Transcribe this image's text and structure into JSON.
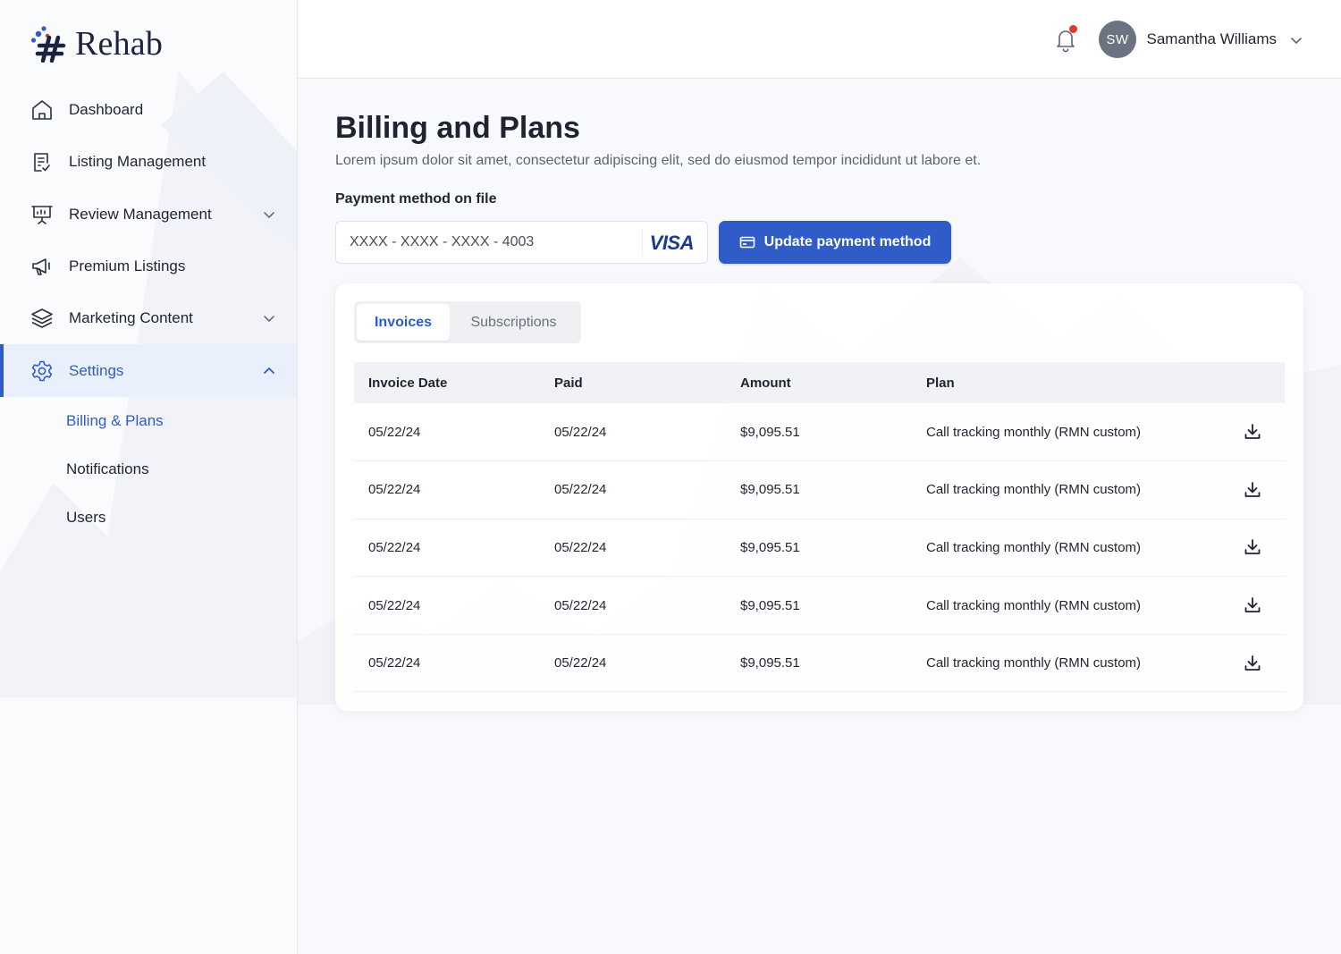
{
  "brand": {
    "name": "Rehab"
  },
  "sidebar": {
    "items": [
      {
        "label": "Dashboard",
        "icon": "home-icon"
      },
      {
        "label": "Listing Management",
        "icon": "document-check-icon"
      },
      {
        "label": "Review Management",
        "icon": "presentation-icon",
        "expandable": true
      },
      {
        "label": "Premium Listings",
        "icon": "megaphone-icon"
      },
      {
        "label": "Marketing Content",
        "icon": "layers-icon",
        "expandable": true
      },
      {
        "label": "Settings",
        "icon": "gear-icon",
        "expandable": true,
        "expanded": true,
        "active": true
      }
    ],
    "settings_sub": [
      {
        "label": "Billing & Plans",
        "active": true
      },
      {
        "label": "Notifications"
      },
      {
        "label": "Users"
      }
    ]
  },
  "header": {
    "user_initials": "SW",
    "user_name": "Samantha Williams",
    "has_notification": true
  },
  "page": {
    "title": "Billing and Plans",
    "description": "Lorem ipsum dolor sit amet, consectetur adipiscing elit, sed do eiusmod tempor incididunt ut labore et.",
    "payment_label": "Payment method on file",
    "card_number": "XXXX - XXXX - XXXX - 4003",
    "card_brand": "VISA",
    "update_button": "Update payment method"
  },
  "tabs": [
    {
      "label": "Invoices",
      "active": true
    },
    {
      "label": "Subscriptions",
      "active": false
    }
  ],
  "table": {
    "columns": [
      "Invoice Date",
      "Paid",
      "Amount",
      "Plan"
    ],
    "rows": [
      {
        "date": "05/22/24",
        "paid": "05/22/24",
        "amount": "$9,095.51",
        "plan": "Call tracking monthly (RMN custom)"
      },
      {
        "date": "05/22/24",
        "paid": "05/22/24",
        "amount": "$9,095.51",
        "plan": "Call tracking monthly (RMN custom)"
      },
      {
        "date": "05/22/24",
        "paid": "05/22/24",
        "amount": "$9,095.51",
        "plan": "Call tracking monthly (RMN custom)"
      },
      {
        "date": "05/22/24",
        "paid": "05/22/24",
        "amount": "$9,095.51",
        "plan": "Call tracking monthly (RMN custom)"
      },
      {
        "date": "05/22/24",
        "paid": "05/22/24",
        "amount": "$9,095.51",
        "plan": "Call tracking monthly (RMN custom)"
      }
    ]
  },
  "colors": {
    "accent": "#2f5cc8",
    "active_bg": "#e9f0fb",
    "notification_dot": "#d93a2f",
    "avatar_bg": "#6b7280"
  }
}
